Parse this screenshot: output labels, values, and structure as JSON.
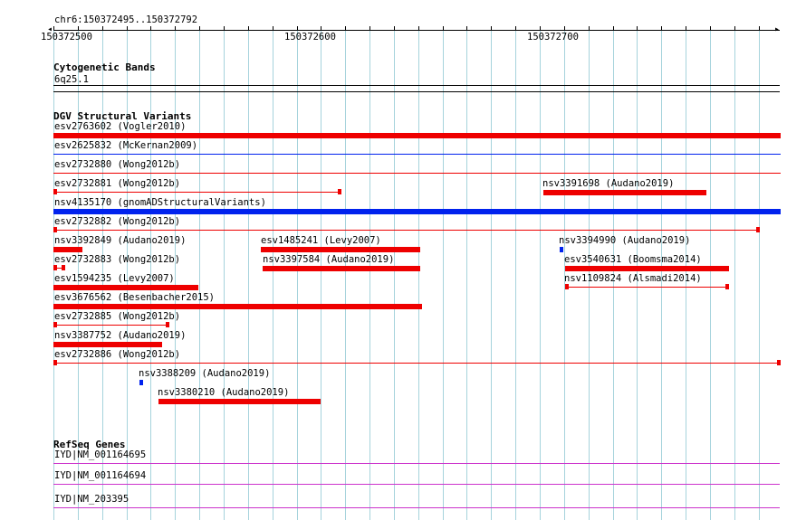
{
  "ruler": {
    "region": "chr6:150372495..150372792",
    "ticks": [
      {
        "label": "150372500",
        "pos": 150372500
      },
      {
        "label": "150372600",
        "pos": 150372600
      },
      {
        "label": "150372700",
        "pos": 150372700
      }
    ]
  },
  "cytoband": {
    "title": "Cytogenetic Bands",
    "band": "6q25.1"
  },
  "dgv": {
    "title": "DGV Structural Variants",
    "colors": {
      "red": "#ee0000",
      "blue": "#0022ee"
    },
    "features": [
      {
        "label": "esv2763602 (Vogler2010)",
        "color": "red",
        "type": "thick"
      },
      {
        "label": "esv2625832 (McKernan2009)",
        "color": "blue",
        "type": "thin"
      },
      {
        "label": "esv2732880 (Wong2012b)",
        "color": "red",
        "type": "thin"
      },
      {
        "label": "esv2732881 (Wong2012b)",
        "color": "red",
        "type": "thin-capped"
      },
      {
        "label": "nsv3391698 (Audano2019)",
        "color": "red",
        "type": "thick"
      },
      {
        "label": "nsv4135170 (gnomADStructuralVariants)",
        "color": "blue",
        "type": "thick"
      },
      {
        "label": "esv2732882 (Wong2012b)",
        "color": "red",
        "type": "thin-capped"
      },
      {
        "label": "nsv3392849 (Audano2019)",
        "color": "red",
        "type": "thick"
      },
      {
        "label": "esv1485241 (Levy2007)",
        "color": "red",
        "type": "thick"
      },
      {
        "label": "nsv3394990 (Audano2019)",
        "color": "blue",
        "type": "thick"
      },
      {
        "label": "esv2732883 (Wong2012b)",
        "color": "red",
        "type": "thin-capped"
      },
      {
        "label": "nsv3397584 (Audano2019)",
        "color": "red",
        "type": "thick"
      },
      {
        "label": "esv3540631 (Boomsma2014)",
        "color": "red",
        "type": "thick"
      },
      {
        "label": "esv1594235 (Levy2007)",
        "color": "red",
        "type": "thick"
      },
      {
        "label": "nsv1109824 (Alsmadi2014)",
        "color": "red",
        "type": "thin-capped"
      },
      {
        "label": "esv3676562 (Besenbacher2015)",
        "color": "red",
        "type": "thick"
      },
      {
        "label": "esv2732885 (Wong2012b)",
        "color": "red",
        "type": "thin-capped"
      },
      {
        "label": "nsv3387752 (Audano2019)",
        "color": "red",
        "type": "thick"
      },
      {
        "label": "esv2732886 (Wong2012b)",
        "color": "red",
        "type": "thin-capped"
      },
      {
        "label": "nsv3388209 (Audano2019)",
        "color": "blue",
        "type": "thick"
      },
      {
        "label": "nsv3380210 (Audano2019)",
        "color": "red",
        "type": "thick"
      }
    ]
  },
  "refseq": {
    "title": "RefSeq Genes",
    "color": "#cc33cc",
    "genes": [
      {
        "label": "IYD|NM_001164695"
      },
      {
        "label": "IYD|NM_001164694"
      },
      {
        "label": "IYD|NM_203395"
      }
    ]
  }
}
